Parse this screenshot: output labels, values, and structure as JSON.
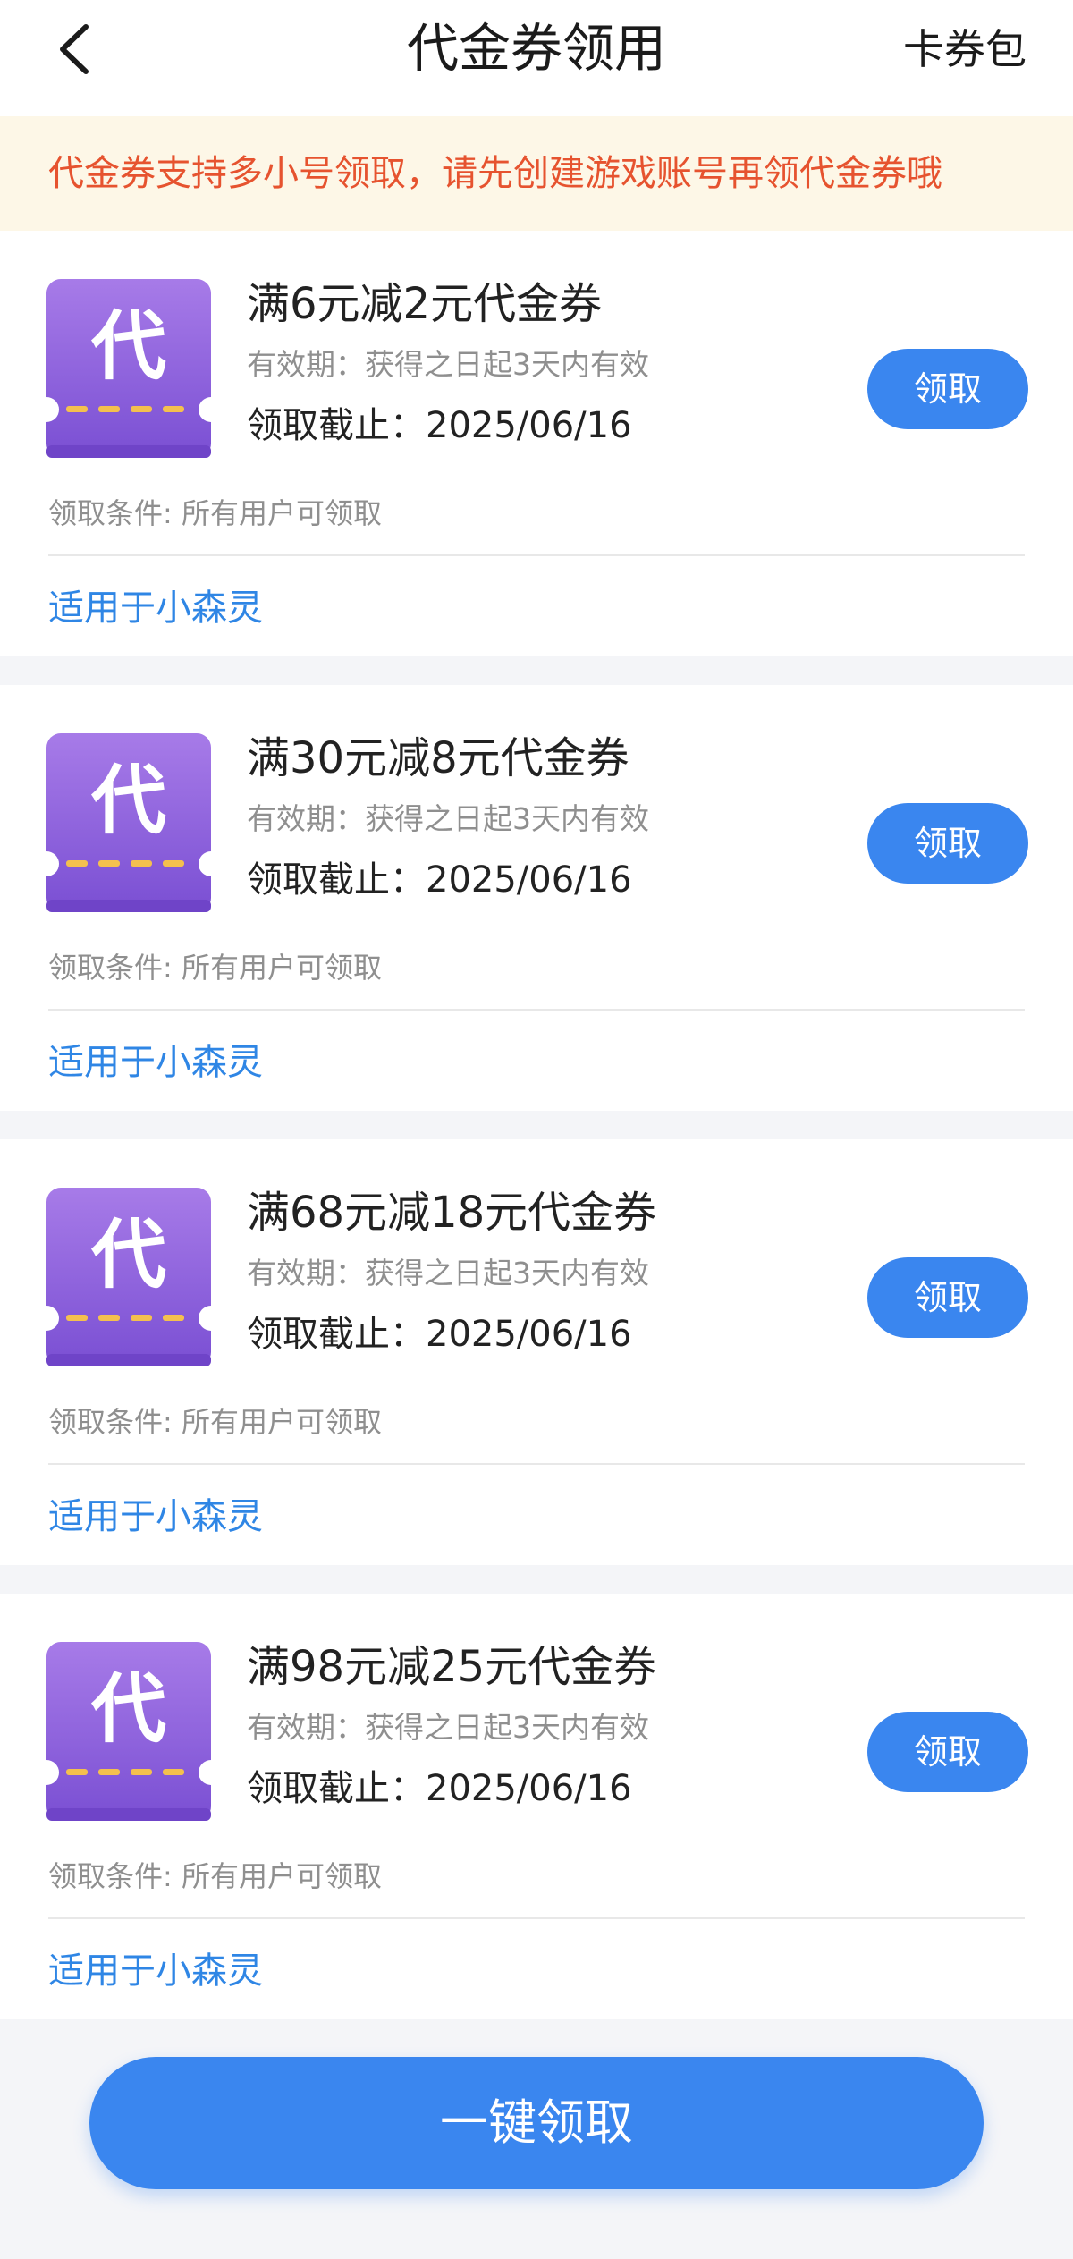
{
  "header": {
    "title": "代金券领用",
    "right_label": "卡券包",
    "back_icon": "chevron-left-icon"
  },
  "notice": {
    "text": "代金券支持多小号领取，请先创建游戏账号再领代金券哦"
  },
  "coupons": [
    {
      "icon_glyph": "代",
      "title": "满6元减2元代金券",
      "validity": "有效期：获得之日起3天内有效",
      "deadline": "领取截止：2025/06/16",
      "claim_label": "领取",
      "condition": "领取条件: 所有用户可领取",
      "applicable": "适用于小森灵"
    },
    {
      "icon_glyph": "代",
      "title": "满30元减8元代金券",
      "validity": "有效期：获得之日起3天内有效",
      "deadline": "领取截止：2025/06/16",
      "claim_label": "领取",
      "condition": "领取条件: 所有用户可领取",
      "applicable": "适用于小森灵"
    },
    {
      "icon_glyph": "代",
      "title": "满68元减18元代金券",
      "validity": "有效期：获得之日起3天内有效",
      "deadline": "领取截止：2025/06/16",
      "claim_label": "领取",
      "condition": "领取条件: 所有用户可领取",
      "applicable": "适用于小森灵"
    },
    {
      "icon_glyph": "代",
      "title": "满98元减25元代金券",
      "validity": "有效期：获得之日起3天内有效",
      "deadline": "领取截止：2025/06/16",
      "claim_label": "领取",
      "condition": "领取条件: 所有用户可领取",
      "applicable": "适用于小森灵"
    }
  ],
  "footer": {
    "one_key_label": "一键领取"
  },
  "colors": {
    "accent": "#3a86ef",
    "notice_text": "#e6532f",
    "notice_bg": "#fdf7e7",
    "coupon_icon_top": "#a77be8",
    "coupon_icon_bottom": "#6e41c7",
    "link": "#2f86e5"
  }
}
